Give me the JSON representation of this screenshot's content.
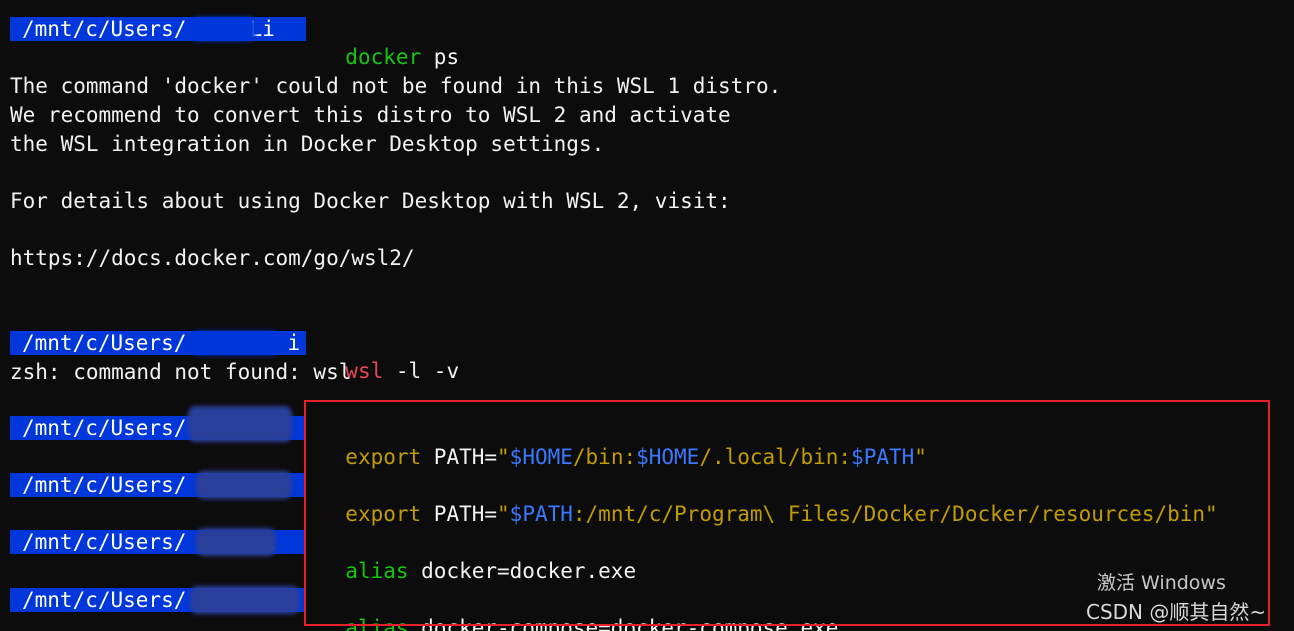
{
  "terminal": {
    "prompts": {
      "p1": "/mnt/c/Users/     Li",
      "p2": "/mnt/c/Users/        i",
      "p3": "/mnt/c/Users/      ",
      "p4": "/mnt/c/Users/      ",
      "p5": "/mnt/c/Users/      i",
      "p6": "/mnt/c/Users/      "
    },
    "cmd1": {
      "name": "docker",
      "args": " ps"
    },
    "output1": [
      "The command 'docker' could not be found in this WSL 1 distro.",
      "We recommend to convert this distro to WSL 2 and activate",
      "the WSL integration in Docker Desktop settings.",
      "For details about using Docker Desktop with WSL 2, visit:",
      "https://docs.docker.com/go/wsl2/"
    ],
    "cmd2": {
      "name": "wsl",
      "args": " -l -v"
    },
    "output2": "zsh: command not found: wsl",
    "cmd3": {
      "keyword": "export",
      "var": " PATH=",
      "q1": "\"",
      "home1": "$HOME",
      "mid1": "/bin:",
      "home2": "$HOME",
      "mid2": "/.local/bin:",
      "path": "$PATH",
      "q2": "\""
    },
    "cmd4": {
      "keyword": "export",
      "var": " PATH=",
      "q1": "\"",
      "path": "$PATH",
      "rest": ":/mnt/c/Program\\ Files/Docker/Docker/resources/bin\""
    },
    "cmd5": {
      "keyword": "alias",
      "rest": " docker=docker.exe"
    },
    "cmd6": {
      "keyword": "alias",
      "rest": " docker-compose=docker-compose.exe"
    }
  },
  "watermark": {
    "activate": "激活 Windows",
    "csdn": "CSDN @顺其自然~"
  },
  "colors": {
    "prompt_bg": "#0037da",
    "green": "#16c60c",
    "red": "#e74856",
    "yellow": "#c19c00",
    "blue": "#3b78ff",
    "highlight_box": "#e8202a"
  }
}
